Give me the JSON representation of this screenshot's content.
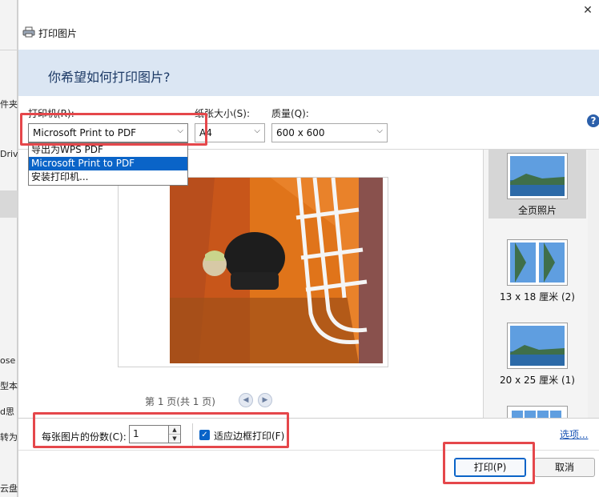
{
  "background_app": {
    "fragments": [
      "件夹",
      "Driv",
      "ose",
      "型本",
      "d思",
      "转为",
      "云盘"
    ]
  },
  "window": {
    "title": "打印图片",
    "close_glyph": "✕"
  },
  "banner": {
    "heading": "你希望如何打印图片?"
  },
  "controls": {
    "printer_label": "打印机(R):",
    "printer_value": "Microsoft Print to PDF",
    "paper_label": "纸张大小(S):",
    "paper_value": "A4",
    "quality_label": "质量(Q):",
    "quality_value": "600 x 600",
    "chevron": "⌵"
  },
  "printer_dropdown": {
    "options": [
      "导出为WPS PDF",
      "Microsoft Print to PDF",
      "安装打印机..."
    ],
    "selected_index": 1
  },
  "help": {
    "glyph": "?"
  },
  "preview": {
    "page_info": "第 1 页(共 1 页)",
    "prev_glyph": "◀",
    "next_glyph": "▶"
  },
  "layouts": [
    {
      "label": "全页照片",
      "selected": true
    },
    {
      "label": "13 x 18 厘米 (2)",
      "selected": false
    },
    {
      "label": "20 x 25 厘米 (1)",
      "selected": false
    }
  ],
  "options": {
    "copies_label": "每张图片的份数(C):",
    "copies_value": "1",
    "fit_label": "适应边框打印(F)",
    "fit_checked": true,
    "check_glyph": "✓",
    "options_link": "选项..."
  },
  "buttons": {
    "print": "打印(P)",
    "cancel": "取消"
  },
  "colors": {
    "accent": "#0a64c8",
    "highlight": "#e5474b",
    "banner": "#dbe6f3"
  }
}
